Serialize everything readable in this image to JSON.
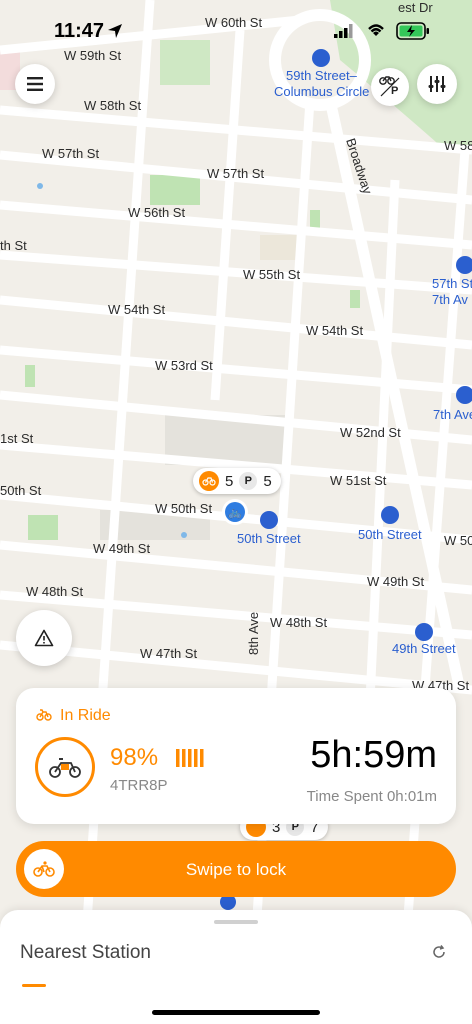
{
  "status_bar": {
    "time": "11:47"
  },
  "map": {
    "streets": [
      "W 60th St",
      "W 59th St",
      "W 58th St",
      "W 57th St",
      "W 57th St",
      "W 56th St",
      "W 55th St",
      "W 54th St",
      "W 54th St",
      "W 53rd St",
      "W 52nd St",
      "W 51st St",
      "W 50th St",
      "W 49th St",
      "W 49th St",
      "W 48th St",
      "W 48th St",
      "W 47th St",
      "W 47th St",
      "Broadway",
      "8th Ave",
      "1st St",
      "50th St",
      "th St",
      "W 50",
      "W 58",
      "est Dr"
    ],
    "transit": [
      "59th Street–",
      "Columbus Circle",
      "57th St",
      "7th Av",
      "7th Ave",
      "50th Street",
      "50th Street",
      "49th Street"
    ],
    "station_pin": {
      "bikes": "5",
      "parking_label": "P",
      "parking": "5"
    },
    "lower_pin": {
      "bikes": "3",
      "parking_label": "P",
      "parking": "7"
    }
  },
  "filter_badge": {
    "label": "P"
  },
  "ride_card": {
    "status": "In Ride",
    "battery": "98%",
    "bike_id": "4TRR8P",
    "duration": "5h:59m",
    "time_spent": "Time Spent 0h:01m"
  },
  "swipe": {
    "label": "Swipe to lock"
  },
  "sheet": {
    "title": "Nearest Station"
  },
  "colors": {
    "accent": "#ff8a00",
    "transit": "#2b5fcf",
    "map_bg": "#f2efe9"
  }
}
